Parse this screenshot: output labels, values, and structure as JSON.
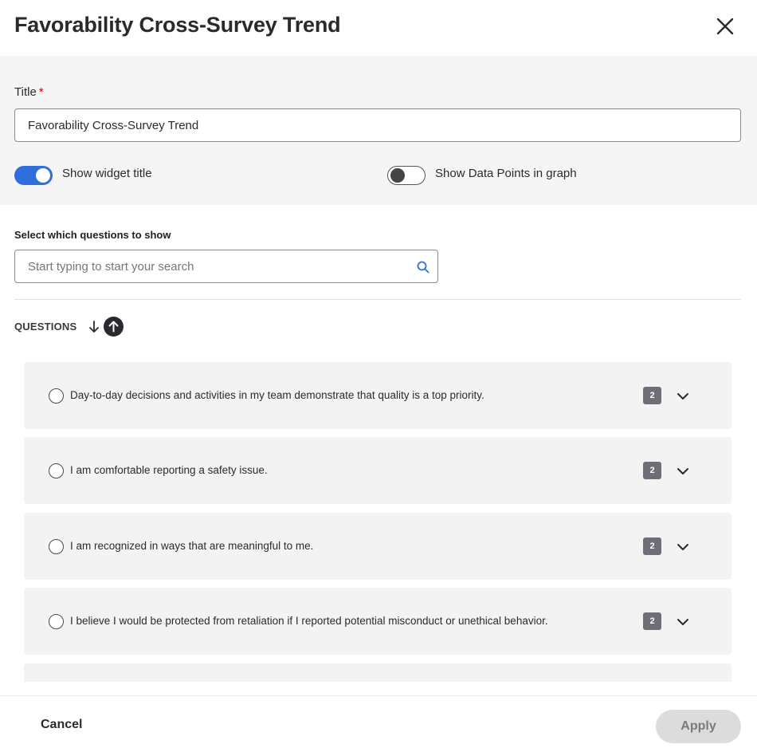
{
  "header": {
    "title": "Favorability Cross-Survey Trend",
    "close_icon": "close-icon"
  },
  "settings": {
    "title_label": "Title",
    "required_marker": "*",
    "title_value": "Favorability Cross-Survey Trend",
    "show_widget_title": {
      "label": "Show widget title",
      "on": true
    },
    "show_data_points": {
      "label": "Show Data Points in graph",
      "on": false
    }
  },
  "questions_section": {
    "select_label": "Select which questions to show",
    "search_placeholder": "Start typing to start your search",
    "search_icon": "search-icon",
    "header_label": "QUESTIONS",
    "sort_icons": [
      "arrow-down-icon",
      "arrow-up-icon"
    ],
    "items": [
      {
        "text": "Day-to-day decisions and activities in my team demonstrate that quality is a top priority.",
        "count": "2"
      },
      {
        "text": "I am comfortable reporting a safety issue.",
        "count": "2"
      },
      {
        "text": "I am recognized in ways that are meaningful to me.",
        "count": "2"
      },
      {
        "text": "I believe I would be protected from retaliation if I reported potential misconduct or unethical behavior.",
        "count": "2"
      }
    ]
  },
  "footer": {
    "cancel_label": "Cancel",
    "apply_label": "Apply"
  },
  "colors": {
    "accent": "#2f6fdb",
    "panel": "#f5f5f5",
    "card": "#f3f3f3",
    "badge": "#6e6e78",
    "apply_disabled": "#dcdcdc"
  }
}
